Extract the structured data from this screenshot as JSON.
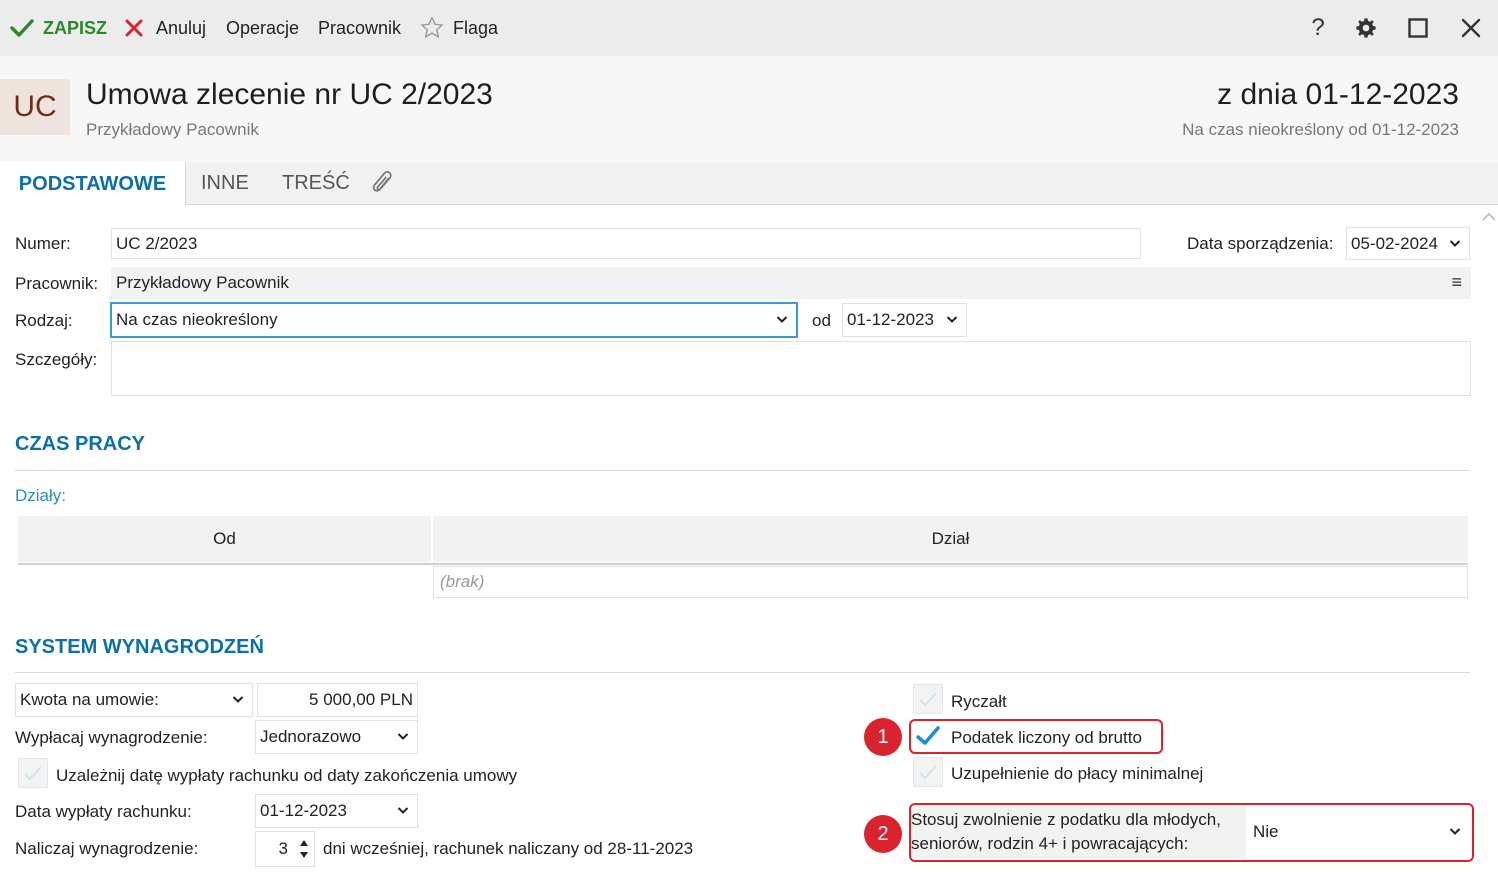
{
  "toolbar": {
    "save": "ZAPISZ",
    "cancel": "Anuluj",
    "operations": "Operacje",
    "employee": "Pracownik",
    "flag": "Flaga"
  },
  "header": {
    "badge": "UC",
    "title": "Umowa zlecenie nr UC 2/2023",
    "subtitle": "Przykładowy Pacownik",
    "date": "z dnia 01-12-2023",
    "period": "Na czas nieokreślony od 01-12-2023"
  },
  "tabs": [
    "PODSTAWOWE",
    "INNE",
    "TREŚĆ"
  ],
  "form": {
    "numer_label": "Numer:",
    "numer_value": "UC 2/2023",
    "data_sporz_label": "Data sporządzenia:",
    "data_sporz_value": "05-02-2024",
    "pracownik_label": "Pracownik:",
    "pracownik_value": "Przykładowy Pacownik",
    "rodzaj_label": "Rodzaj:",
    "rodzaj_value": "Na czas nieokreślony",
    "od_label": "od",
    "od_value": "01-12-2023",
    "szczegoly_label": "Szczegóły:",
    "szczegoly_value": ""
  },
  "czas_pracy": {
    "title": "CZAS PRACY",
    "dzialy_label": "Działy:",
    "columns": [
      "Od",
      "Dział"
    ],
    "empty": "(brak)"
  },
  "system": {
    "title": "SYSTEM WYNAGRODZEŃ",
    "kwota_select": "Kwota na umowie:",
    "kwota_value": "5 000,00 PLN",
    "wyplacaj_label": "Wypłacaj wynagrodzenie:",
    "wyplacaj_value": "Jednorazowo",
    "uzaleznij_label": "Uzależnij datę wypłaty rachunku od daty zakończenia umowy",
    "uzaleznij_checked": false,
    "data_wyplaty_label": "Data wypłaty rachunku:",
    "data_wyplaty_value": "01-12-2023",
    "naliczaj_label": "Naliczaj wynagrodzenie:",
    "naliczaj_value": "3",
    "naliczaj_suffix": "dni wcześniej, rachunek naliczany od 28-11-2023",
    "ryczalt_label": "Ryczałt",
    "ryczalt_checked": false,
    "podatek_label": "Podatek liczony od brutto",
    "podatek_checked": true,
    "uzupelnienie_label": "Uzupełnienie do płacy minimalnej",
    "uzupelnienie_checked": false,
    "zwolnienie_label_1": "Stosuj zwolnienie z podatku dla młodych,",
    "zwolnienie_label_2": "seniorów, rodzin 4+ i powracających:",
    "zwolnienie_value": "Nie"
  },
  "annotations": [
    "1",
    "2"
  ],
  "colors": {
    "accent": "#0d6fa6",
    "save_green": "#2a8a2a",
    "cancel_red": "#d9232e",
    "highlight_red": "#d9232e",
    "check_blue": "#1a8fd6"
  }
}
